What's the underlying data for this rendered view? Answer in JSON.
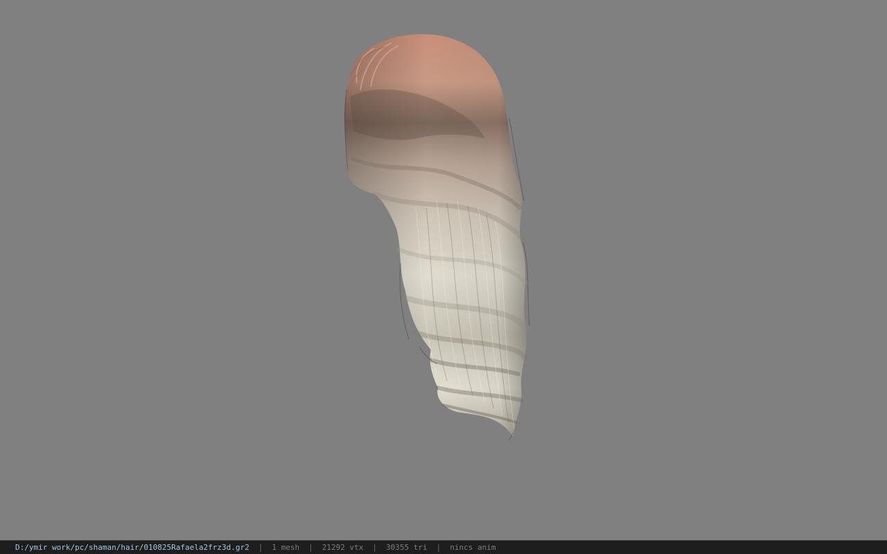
{
  "viewport": {
    "background_color": "#808080",
    "model": "hair-mesh"
  },
  "statusbar": {
    "file_path": "D:/ymir work/pc/shaman/hair/010825Rafaela2frz3d.gr2",
    "mesh_count": "1 mesh",
    "vertex_count": "21292 vtx",
    "triangle_count": "30355 tri",
    "anim_status": "nincs anim",
    "separator": "|"
  },
  "colors": {
    "path_text": "#9ec8e0",
    "info_text": "#7d7d7d",
    "statusbar_bg": "#1e1e1e",
    "hair_root": "#c8907a",
    "hair_tip": "#ddd9cc"
  }
}
